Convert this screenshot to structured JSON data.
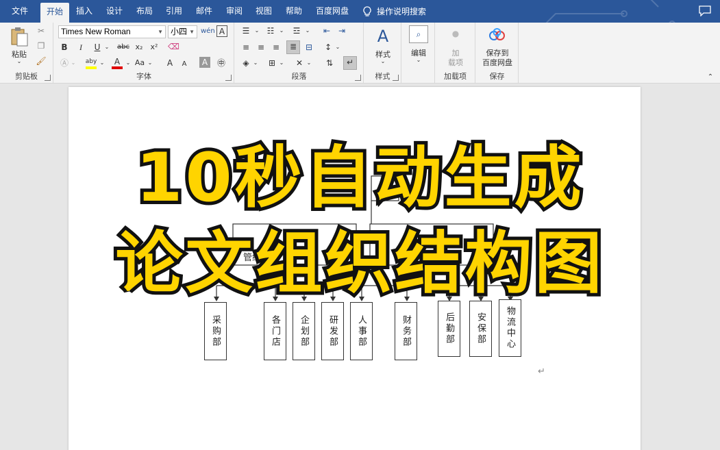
{
  "tabs": [
    "文件",
    "开始",
    "插入",
    "设计",
    "布局",
    "引用",
    "邮件",
    "审阅",
    "视图",
    "帮助",
    "百度网盘"
  ],
  "active_tab": "开始",
  "tell_me": "操作说明搜索",
  "clipboard": {
    "paste_label": "粘贴",
    "group_label": "剪贴板"
  },
  "font": {
    "name": "Times New Roman",
    "size": "小四",
    "group_label": "字体",
    "bold": "B",
    "italic": "I",
    "underline": "U",
    "strike": "abc",
    "subscript": "x₂",
    "superscript": "x²",
    "grow": "A",
    "shrink": "A",
    "case": "Aa",
    "pinyin": "wén",
    "charborder": "A",
    "highlight_label": "aby",
    "font_color_label": "A",
    "highlight_color": "#ffff00",
    "font_color": "#e00000"
  },
  "paragraph": {
    "group_label": "段落"
  },
  "styles": {
    "label": "样式",
    "group_label": "样式"
  },
  "editing": {
    "label": "编辑"
  },
  "addins": {
    "label_line1": "加",
    "label_line2": "载项",
    "group_label": "加载项"
  },
  "save": {
    "label_line1": "保存到",
    "label_line2": "百度网盘",
    "group_label": "保存"
  },
  "document": {
    "partial_labels": [
      "管经",
      "总"
    ],
    "departments": [
      "采购部",
      "各门店",
      "企划部",
      "研发部",
      "人事部",
      "财务部",
      "后勤部",
      "安保部",
      "物流中心"
    ],
    "paragraph_mark": "↵"
  },
  "headline": {
    "line1": "10秒自动生成",
    "line2": "论文组织结构图"
  },
  "colors": {
    "accent": "#2b579a",
    "headline_fill": "#ffd400",
    "headline_stroke": "#111111"
  }
}
